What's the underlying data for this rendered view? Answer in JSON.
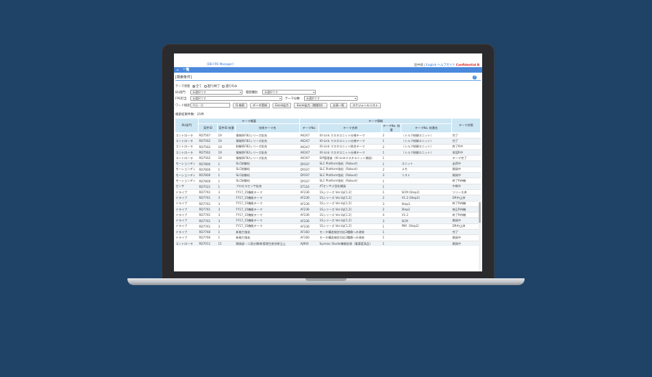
{
  "header": {
    "app_name": "[DB FPE Manager]",
    "user": "田中様",
    "lang": "English",
    "help_link": "ヘルプ",
    "guide_link": "ガイド",
    "confidential": "Confidential B"
  },
  "nav": {
    "home_icon": "home-icon",
    "title": "一覧"
  },
  "section": {
    "title": "[検索条件]",
    "help_icon": "help-icon"
  },
  "form": {
    "theme_state_label": "テーマ状態",
    "radios": [
      "全て",
      "進行/終了",
      "進行のみ"
    ],
    "bu_label": "BU部門",
    "bu_value": "未選択です",
    "dev_label": "開発種別",
    "dev_value": "未選択です",
    "fpe_label": "FPE担当",
    "fpe_value": "未選択です",
    "theme_type_label": "テーマ分類",
    "theme_type_value": "未選択です",
    "word_label": "ワード検索",
    "word_placeholder": "単語一致",
    "buttons": [
      "Q 検索",
      "データ登録",
      "Excel出力",
      "Excel出力（期間別）",
      "全表一覧",
      "スケジュールリスト"
    ]
  },
  "result_count": "検索結果件数：25件",
  "table": {
    "group_headers": [
      "テーマ概要",
      "テーマ情報"
    ],
    "headers": [
      "BU部門",
      "案件ID",
      "案件ID\n枝番",
      "技術テーマ名",
      "テーマNo.",
      "テーマ名称",
      "テーマNo.\n枝番",
      "テーマNo.\n枝番名",
      "テーマ状態"
    ],
    "rows": [
      [
        "コントローラ",
        "RD7567",
        "19",
        "情報系FB2シリーズ拡充",
        "AK247",
        "IO-Link マスタユニット仕様テーマ",
        "2",
        "（トルク制御ユニット）",
        "完了"
      ],
      [
        "コントローラ",
        "RD7562",
        "19",
        "情報系FB2シリーズ拡充",
        "AK247",
        "IO-Link マスタユニット仕様テーマ",
        "1",
        "（トルク制御ユニット）",
        "完了"
      ],
      [
        "コントローラ",
        "RD7562",
        "19",
        "制御系FB2シリーズ拡充",
        "AK247",
        "IO-Link マスタユニット統合テーマ",
        "2",
        "（トルク制御ユニット）",
        "終了R中"
      ],
      [
        "コントローラ",
        "RD7562",
        "19",
        "情報系FB2シリーズ拡充",
        "AK247",
        "IO-Link マスタユニット仕様テーマ",
        "1",
        "（トルク制御ユニット）",
        "承認R中"
      ],
      [
        "コントローラ",
        "RD7562",
        "19",
        "情報系FB2シリーズ拡充",
        "AK197",
        "EIP管理者（IO-Linkマスタユニット開発）",
        "1",
        "",
        "テーマ完了"
      ],
      [
        "モーションディ",
        "RD7800",
        "1",
        "SLC制御化",
        "DY037",
        "SLC Platform強化（Robust）",
        "1",
        "ユニット",
        "出荷中"
      ],
      [
        "モーションディ",
        "RD7800",
        "1",
        "SLC制御化",
        "DY037",
        "SLC Platform強化（Robust）",
        "2",
        "メモ",
        "開発中"
      ],
      [
        "モーションディ",
        "RD7800",
        "1",
        "SLC制御化",
        "DY037",
        "SLC Platform強化（Robust）",
        "3",
        "リスト",
        "開発中"
      ],
      [
        "モーションディ",
        "RD7800",
        "1",
        "SLC制御化",
        "DY037",
        "SLC Platform強化（Robust）",
        "1",
        "",
        "終了R待機"
      ],
      [
        "センサ",
        "RD7521",
        "1",
        "プロセスセンサ拡充",
        "ST116",
        "ATセンサ小型化開発",
        "1",
        "",
        "中断中"
      ],
      [
        "ドライブ",
        "RD7761",
        "3",
        "FY17_15機能テーマ",
        "AF236",
        "1Sシリーズ Ver.Up[1.2]",
        "1",
        "SCM (Step2)",
        "リリース済"
      ],
      [
        "ドライブ",
        "RD7761",
        "3",
        "FY17_15機能テーマ",
        "AF236",
        "1Sシリーズ Ver.Up[1.2]",
        "2",
        "V1.2 (Step2)",
        "DR中止済"
      ],
      [
        "ドライブ",
        "RD7761",
        "3",
        "FY17_15機能テーマ",
        "AF236",
        "1Sシリーズ Ver.Up[1.2]",
        "3",
        "Step3",
        "終了R待機"
      ],
      [
        "ドライブ",
        "RD7761",
        "3",
        "FY17_15機能テーマ",
        "AF236",
        "1Sシリーズ Ver.Up[1.2]",
        "2",
        "Step2",
        "修正R待機"
      ],
      [
        "ドライブ",
        "RD7761",
        "3",
        "FY17_15機能テーマ",
        "AF236",
        "1Sシリーズ Ver.Up[1.2]",
        "4",
        "V1.2",
        "終了R待機"
      ],
      [
        "ドライブ",
        "RD7761",
        "3",
        "FY17_15機能テーマ",
        "AF236",
        "1Sシリーズ Ver.Up[1.2]",
        "3",
        "SCM",
        "開発中"
      ],
      [
        "ドライブ",
        "RD7761",
        "3",
        "FY17_15機能テーマ",
        "AF236",
        "1Sシリーズ Ver.Up[1.2]",
        "1",
        "PMI（Step2）",
        "DR中止済"
      ],
      [
        "ドライブ",
        "RD7760",
        "1",
        "新能力強化",
        "AF160",
        "モータ構造検討対応2種類への改修",
        "1",
        "",
        "完了"
      ],
      [
        "ドライブ",
        "RD7760",
        "1",
        "新能力強化",
        "AF160",
        "モータ構造検討対応2種類への改修",
        "1",
        "",
        "開発中"
      ],
      [
        "コントローラ",
        "RD7011",
        "11",
        "開発部・二段分類/新管理生産技術立上",
        "AJ900",
        "Sysmac Studio機能拡張（重要度高品）",
        "1",
        "",
        "開発中"
      ]
    ]
  }
}
